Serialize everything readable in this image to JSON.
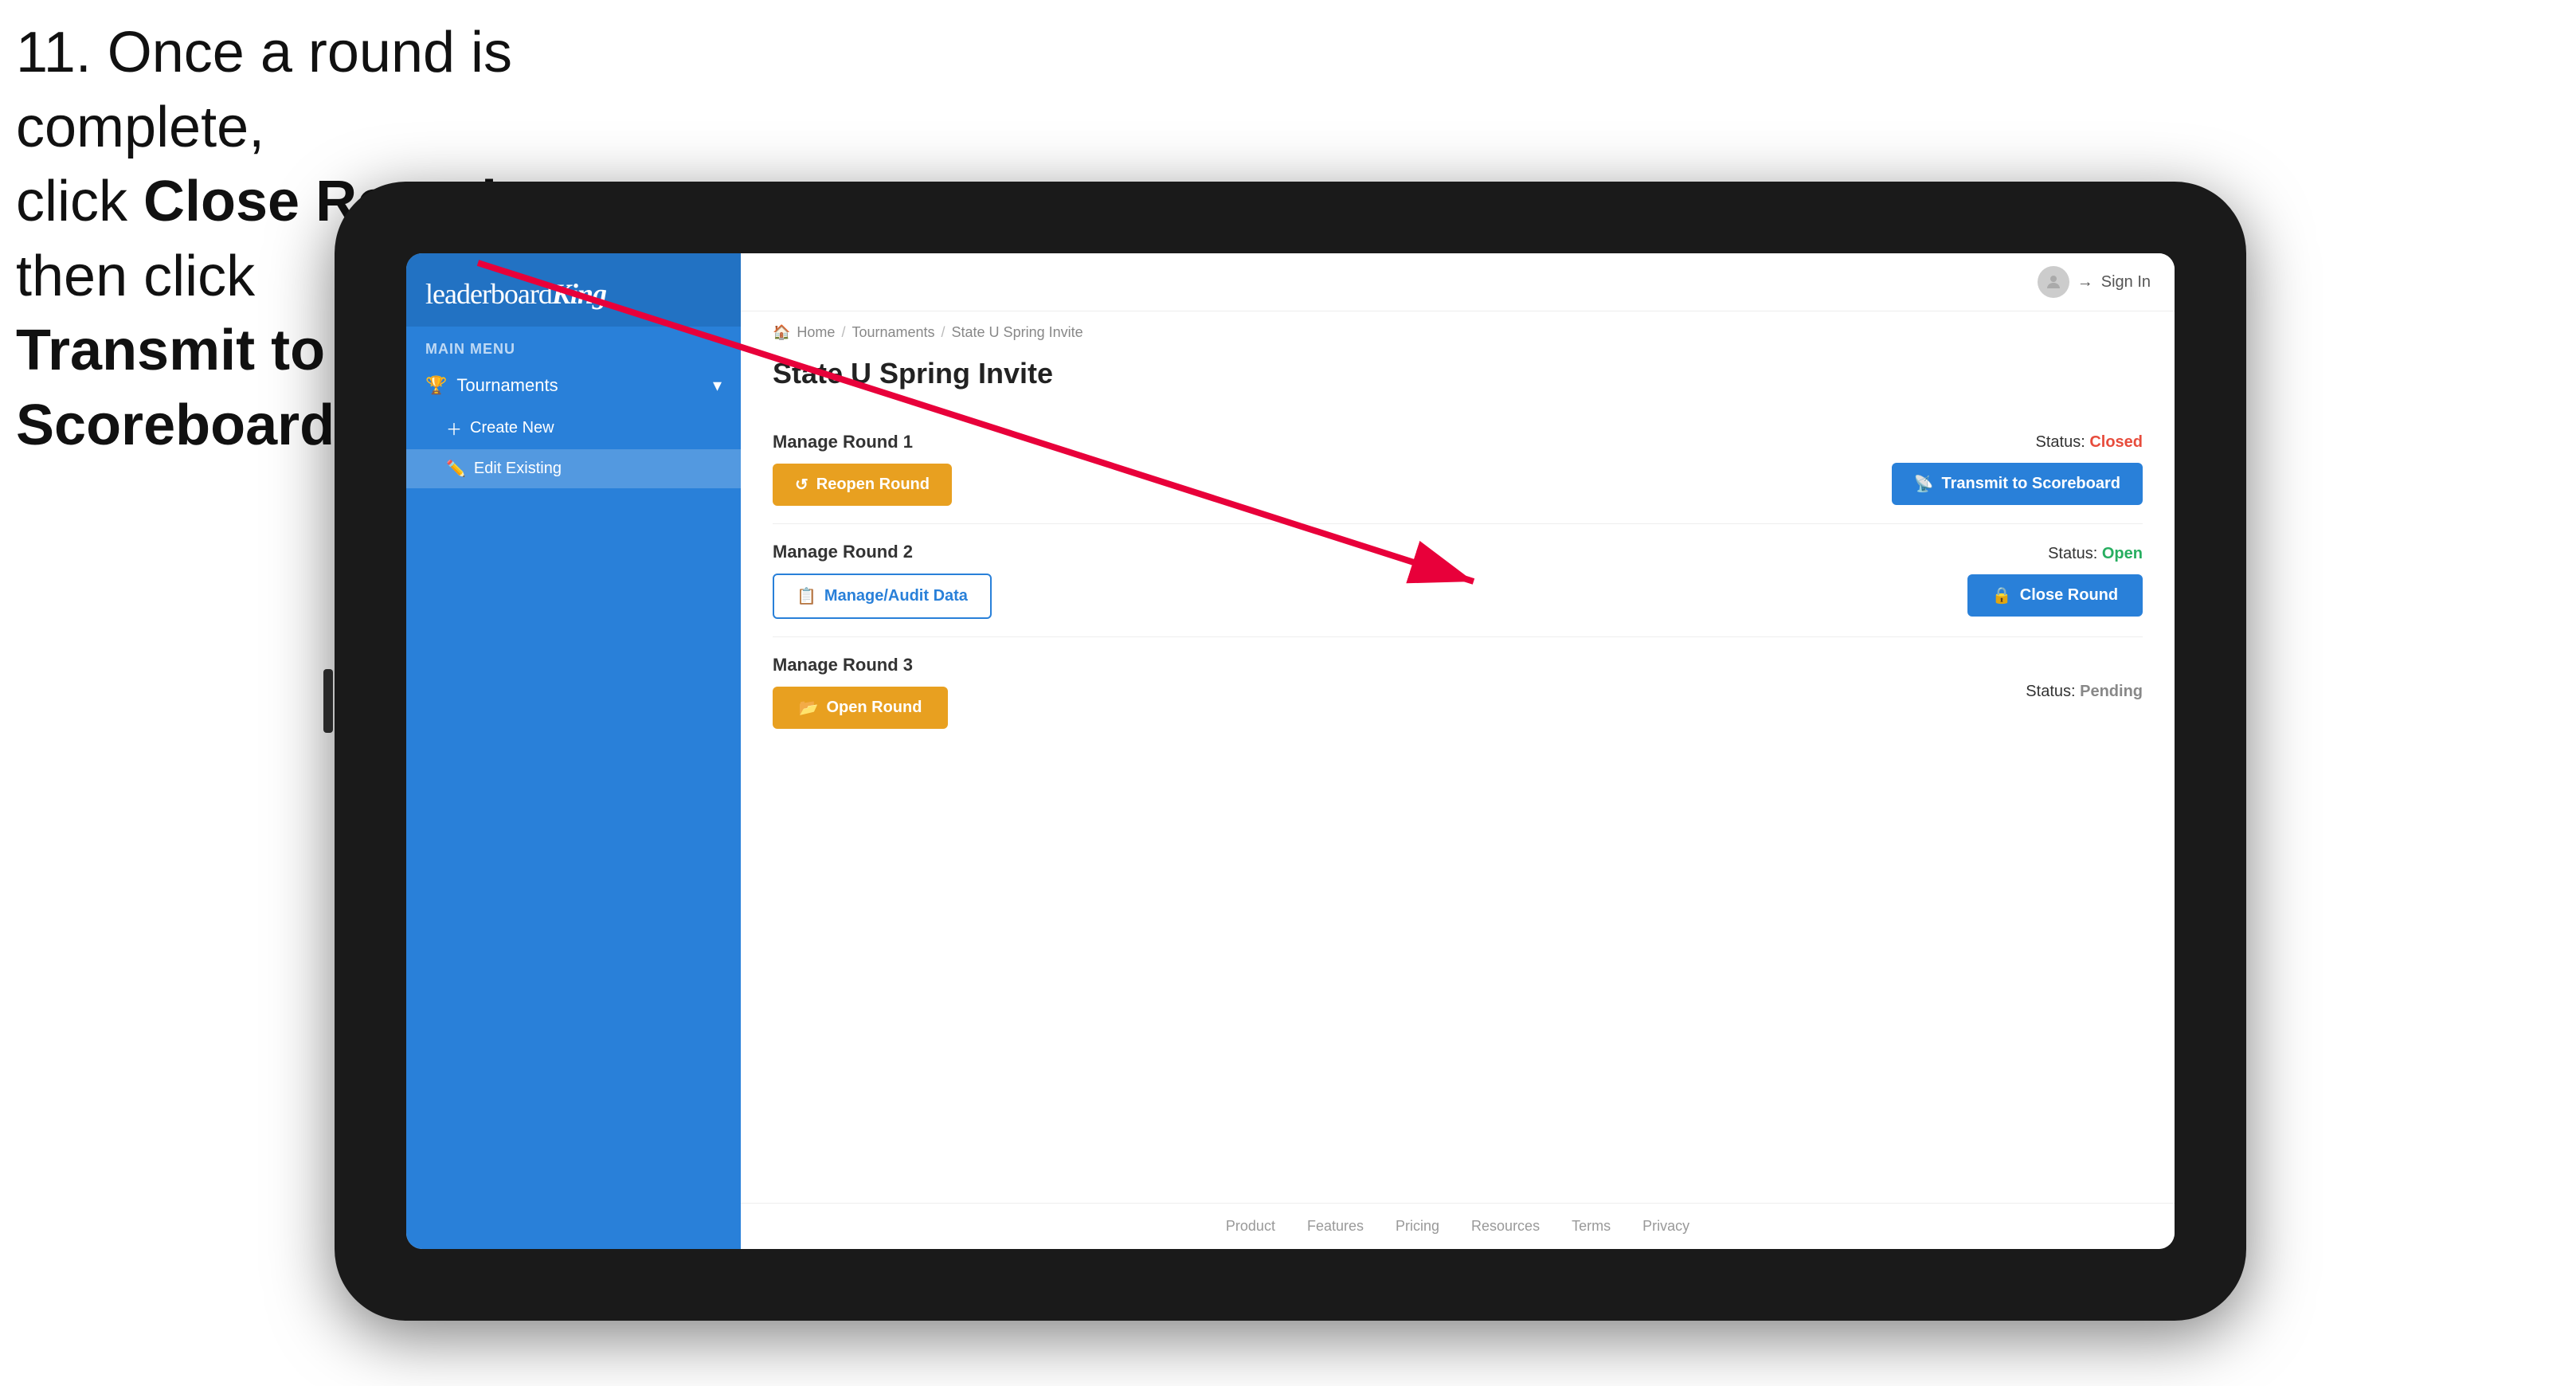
{
  "instruction": {
    "line1": "11. Once a round is complete,",
    "line2": "click ",
    "bold1": "Close Round",
    "line3": " then click",
    "bold2": "Transmit to Scoreboard."
  },
  "sidebar": {
    "logo": {
      "text": "leaderboard",
      "bold": "King"
    },
    "menu_label": "MAIN MENU",
    "nav": {
      "tournaments_label": "Tournaments",
      "create_new_label": "Create New",
      "edit_existing_label": "Edit Existing"
    }
  },
  "topnav": {
    "sign_in": "Sign In"
  },
  "breadcrumb": {
    "home": "Home",
    "tournaments": "Tournaments",
    "current": "State U Spring Invite"
  },
  "page": {
    "title": "State U Spring Invite"
  },
  "rounds": [
    {
      "label": "Manage Round 1",
      "status_prefix": "Status: ",
      "status_value": "Closed",
      "status_class": "status-closed",
      "button1_label": "Reopen Round",
      "button1_class": "btn-orange",
      "button2_label": "Transmit to Scoreboard",
      "button2_class": "btn-blue"
    },
    {
      "label": "Manage Round 2",
      "status_prefix": "Status: ",
      "status_value": "Open",
      "status_class": "status-open",
      "button1_label": "Manage/Audit Data",
      "button1_class": "btn-blue-outline",
      "button2_label": "Close Round",
      "button2_class": "btn-blue"
    },
    {
      "label": "Manage Round 3",
      "status_prefix": "Status: ",
      "status_value": "Pending",
      "status_class": "status-pending",
      "button1_label": "Open Round",
      "button1_class": "btn-orange",
      "button2_label": null,
      "button2_class": null
    }
  ],
  "footer": {
    "links": [
      "Product",
      "Features",
      "Pricing",
      "Resources",
      "Terms",
      "Privacy"
    ]
  }
}
